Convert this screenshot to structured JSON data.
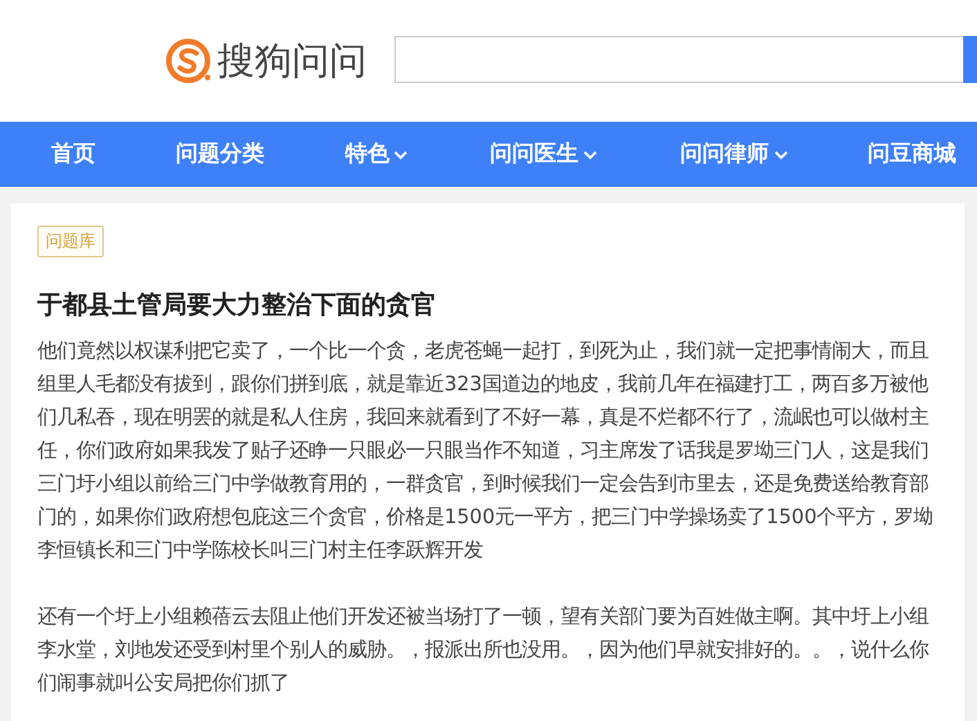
{
  "header": {
    "logo_text": "搜狗问问"
  },
  "nav": [
    {
      "label": "首页",
      "kind": "link"
    },
    {
      "label": "问题分类",
      "kind": "link"
    },
    {
      "label": "特色",
      "kind": "dropdown"
    },
    {
      "label": "问问医生",
      "kind": "dropdown"
    },
    {
      "label": "问问律师",
      "kind": "dropdown"
    },
    {
      "label": "问豆商城",
      "kind": "link"
    }
  ],
  "question": {
    "tag": "问题库",
    "title": "于都县土管局要大力整治下面的贪官",
    "paragraphs": [
      "他们竟然以权谋利把它卖了，一个比一个贪，老虎苍蝇一起打，到死为止，我们就一定把事情闹大，而且组里人毛都没有拔到，跟你们拼到底，就是靠近323国道边的地皮，我前几年在福建打工，两百多万被他们几私吞，现在明罢的就是私人住房，我回来就看到了不好一幕，真是不烂都不行了，流岷也可以做村主任，你们政府如果我发了贴子还睁一只眼必一只眼当作不知道，习主席发了话我是罗坳三门人，这是我们三门圩小组以前给三门中学做教育用的，一群贪官，到时候我们一定会告到市里去，还是免费送给教育部门的，如果你们政府想包庇这三个贪官，价格是1500元一平方，把三门中学操场卖了1500个平方，罗坳李恒镇长和三门中学陈校长叫三门村主任李跃辉开发",
      "还有一个圩上小组赖蓓云去阻止他们开发还被当场打了一顿，望有关部门要为百姓做主啊。其中圩上小组李水堂，刘地发还受到村里个别人的威胁。，报派出所也没用。，因为他们早就安排好的。。，说什么你们闹事就叫公安局把你们抓了"
    ]
  }
}
